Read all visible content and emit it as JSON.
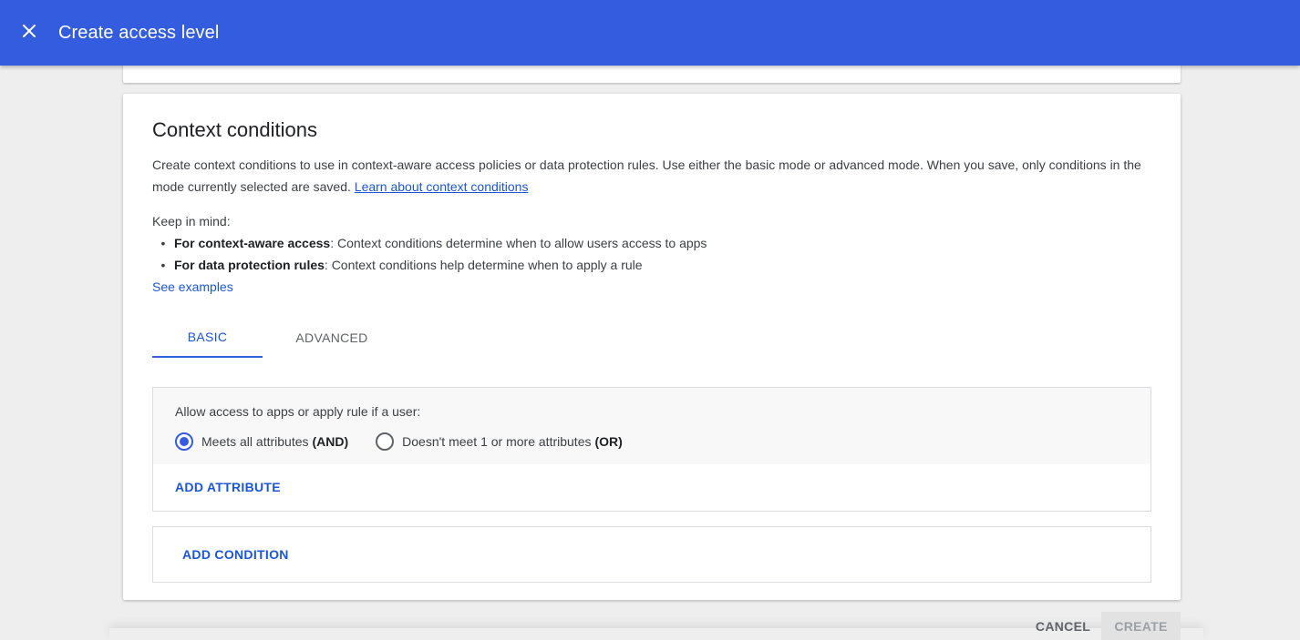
{
  "app_bar": {
    "title": "Create access level",
    "close_icon": "close-icon",
    "color": "#335cde"
  },
  "section": {
    "title": "Context conditions",
    "description": "Create context conditions to use in context-aware access policies or data protection rules. Use either the basic mode or advanced mode. When you save, only conditions in the mode currently selected are saved.",
    "learn_link": "Learn about context conditions",
    "keep_in_mind": "Keep in mind:",
    "bullets": [
      {
        "bold": "For context-aware access",
        "text": ": Context conditions determine when to allow users access to apps"
      },
      {
        "bold": "For data protection rules",
        "text": ": Context conditions help determine when to apply a rule"
      }
    ],
    "see_examples": "See examples"
  },
  "tabs": [
    {
      "label": "BASIC",
      "active": true
    },
    {
      "label": "ADVANCED",
      "active": false
    }
  ],
  "attribute_panel": {
    "prompt": "Allow access to apps or apply rule if a user:",
    "options": [
      {
        "label": "Meets all attributes",
        "bold": "(AND)",
        "selected": true
      },
      {
        "label": "Doesn't meet 1 or more attributes",
        "bold": "(OR)",
        "selected": false
      }
    ],
    "add_attribute": "ADD ATTRIBUTE"
  },
  "condition_panel": {
    "add_condition": "ADD CONDITION"
  },
  "footer": {
    "cancel": "CANCEL",
    "create": "CREATE"
  }
}
